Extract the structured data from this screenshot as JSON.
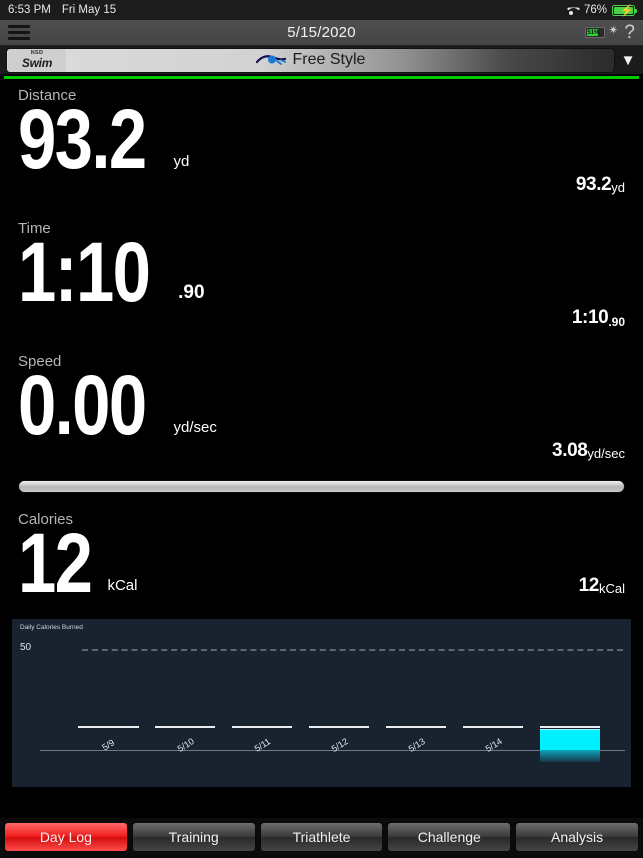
{
  "status_bar": {
    "time": "6:53 PM",
    "date": "Fri May 15",
    "wifi_icon": "wifi-icon",
    "battery_percent": "76%",
    "battery_icon": "battery-charging-icon"
  },
  "nav_bar": {
    "menu_icon": "hamburger-menu-icon",
    "title": "5/15/2020",
    "device_battery": "51%",
    "bluetooth_icon": "bluetooth-icon",
    "help_label": "?"
  },
  "mode_bar": {
    "logo_top": "NSD",
    "logo_main": "Swim",
    "swim_icon": "swimmer-icon",
    "mode_label": "Free Style",
    "dropdown_icon": "chevron-down-icon",
    "accent_color": "#00c900"
  },
  "metrics": [
    {
      "label": "Distance",
      "value": "93.2",
      "sub": "",
      "unit": "yd",
      "total_value": "93.2",
      "total_sub": "",
      "total_unit": "yd"
    },
    {
      "label": "Time",
      "value": "1:10",
      "sub": ".90",
      "unit": "",
      "total_value": "1:10",
      "total_sub": ".90",
      "total_unit": ""
    },
    {
      "label": "Speed",
      "value": "0.00",
      "sub": "",
      "unit": "yd/sec",
      "total_value": "3.08",
      "total_sub": "",
      "total_unit": "yd/sec"
    },
    {
      "label": "Calories",
      "value": "12",
      "sub": "",
      "unit": "kCal",
      "total_value": "12",
      "total_sub": "",
      "total_unit": "kCal"
    }
  ],
  "progress": {
    "percent": 100
  },
  "chart_data": {
    "type": "bar",
    "title": "Daily Calories Burned",
    "xlabel": "",
    "ylabel": "",
    "categories": [
      "5/9",
      "5/10",
      "5/11",
      "5/12",
      "5/13",
      "5/14",
      "5/15"
    ],
    "values": [
      0,
      0,
      0,
      0,
      0,
      0,
      12
    ],
    "ytick_labels": [
      "50"
    ],
    "ylim": [
      0,
      55
    ],
    "goal_line": 50,
    "grid": "dashed-goal-line-only",
    "legend": "none",
    "bar_color": "#00f0ff",
    "background_color": "#18232f"
  },
  "tabs": [
    {
      "label": "Day Log",
      "active": true
    },
    {
      "label": "Training",
      "active": false
    },
    {
      "label": "Triathlete",
      "active": false
    },
    {
      "label": "Challenge",
      "active": false
    },
    {
      "label": "Analysis",
      "active": false
    }
  ]
}
